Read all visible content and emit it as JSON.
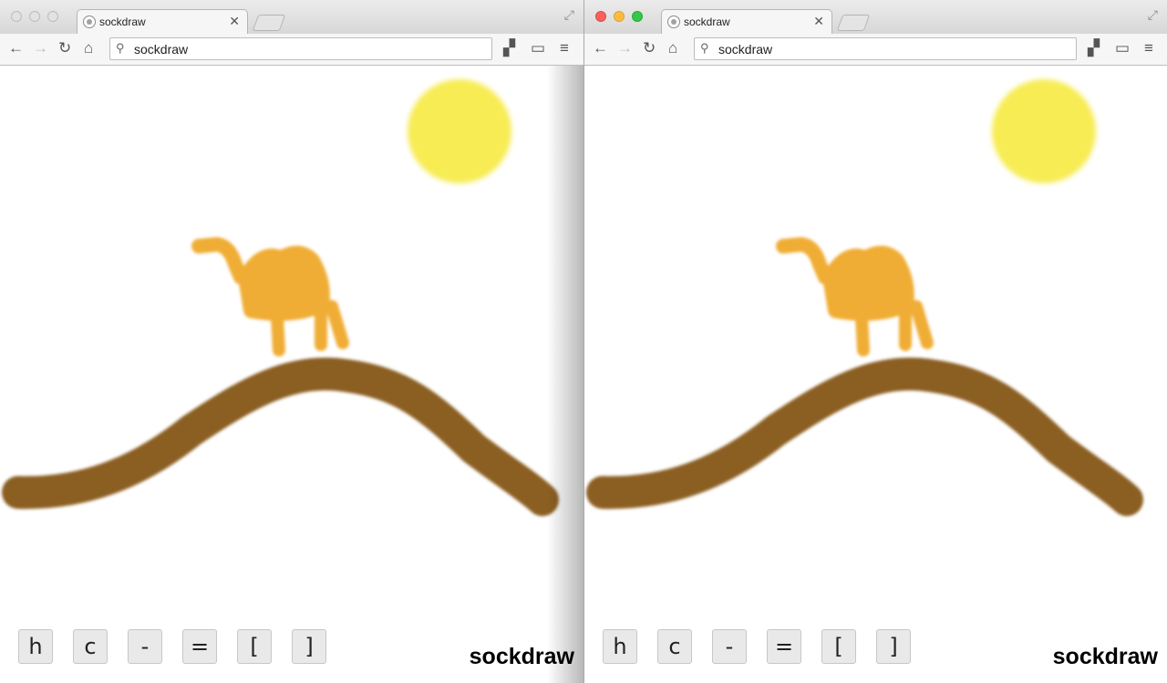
{
  "colors": {
    "sun": "#f7ec52",
    "camel": "#f0ad35",
    "hill": "#8b5e22",
    "button_bg": "#e9e9e9"
  },
  "windows": [
    {
      "tab_title": "sockdraw",
      "address": "sockdraw",
      "buttons": [
        "h",
        "c",
        "-",
        "=",
        "[",
        "]"
      ],
      "brand": "sockdraw"
    },
    {
      "tab_title": "sockdraw",
      "address": "sockdraw",
      "buttons": [
        "h",
        "c",
        "-",
        "=",
        "[",
        "]"
      ],
      "brand": "sockdraw"
    }
  ],
  "icons": {
    "back": "back-arrow-icon",
    "forward": "forward-arrow-icon",
    "reload": "reload-icon",
    "home": "home-icon",
    "search": "search-icon",
    "extension": "extension-icon",
    "cast": "cast-icon",
    "menu": "menu-icon",
    "close": "close-icon",
    "fullscreen": "fullscreen-icon"
  }
}
